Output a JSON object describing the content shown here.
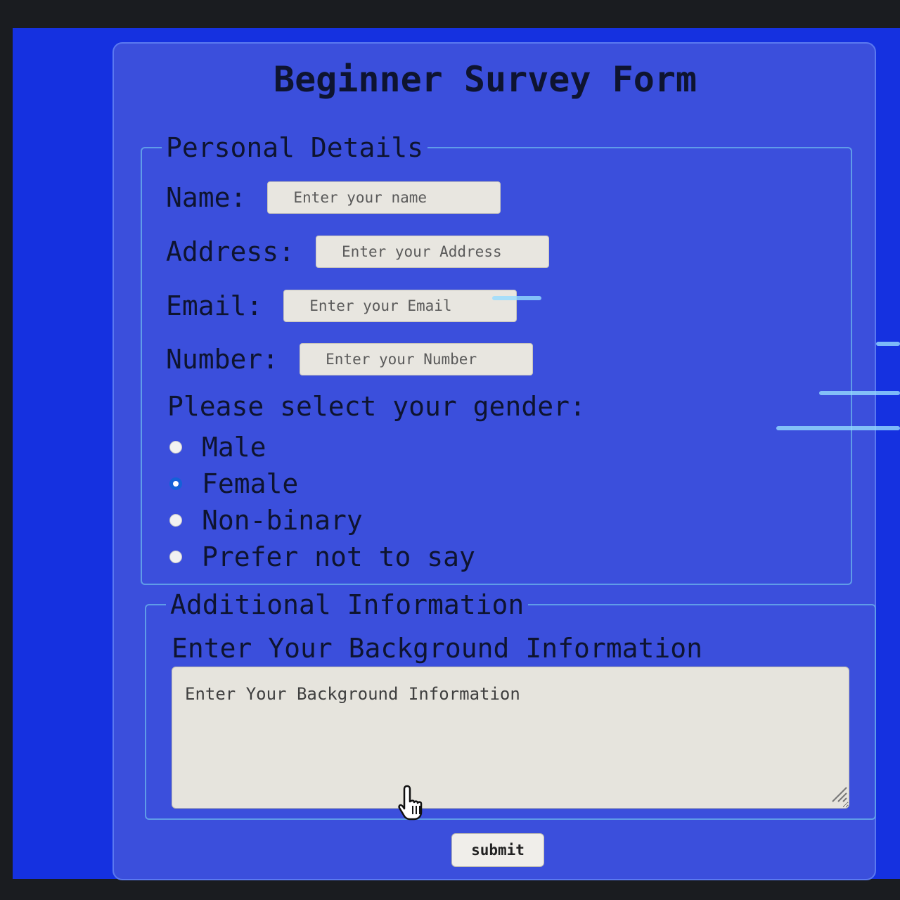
{
  "form": {
    "title": "Beginner Survey Form",
    "personal": {
      "legend": "Personal Details",
      "fields": [
        {
          "label": "Name:",
          "placeholder": "Enter your name"
        },
        {
          "label": "Address:",
          "placeholder": "Enter your Address"
        },
        {
          "label": "Email:",
          "placeholder": "Enter your Email"
        },
        {
          "label": "Number:",
          "placeholder": "Enter your Number"
        }
      ],
      "gender_question": "Please select your gender:",
      "gender_options": [
        "Male",
        "Female",
        "Non-binary",
        "Prefer not to say"
      ],
      "gender_selected": "Female"
    },
    "additional": {
      "legend": "Additional Information",
      "background_label": "Enter Your Background Information",
      "background_placeholder": "Enter Your Background Information"
    },
    "submit_label": "submit"
  },
  "colors": {
    "card_background": "#3b4fdc",
    "outer_background": "#1531e0",
    "text": "#0e1430",
    "border_accent": "#5f9ce8",
    "radio_selected": "#1560d8"
  },
  "icons": [
    "hand-pointer-cursor-icon",
    "resize-grip-icon"
  ]
}
